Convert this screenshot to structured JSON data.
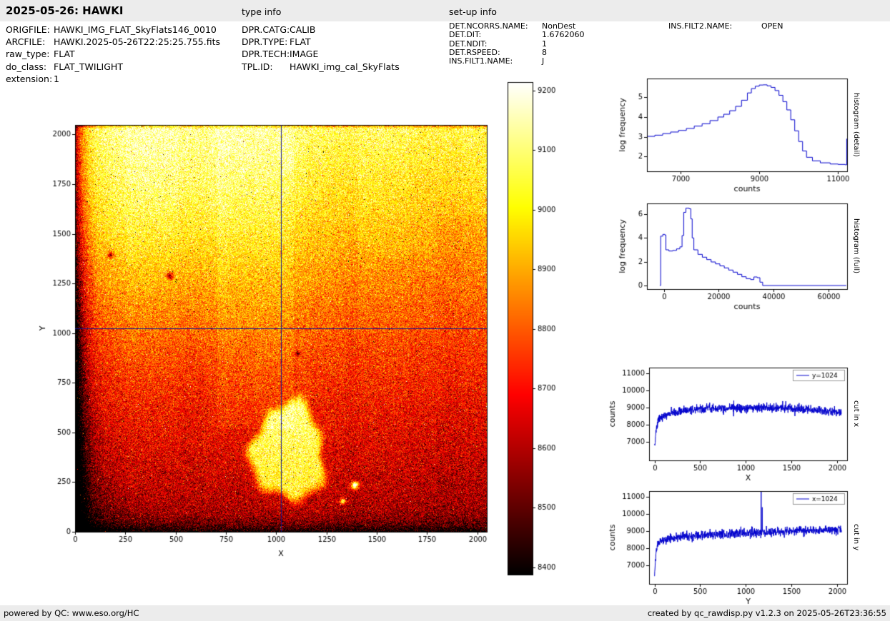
{
  "header": {
    "title": "2025-05-26: HAWKI",
    "type_info_label": "type info",
    "setup_info_label": "set-up info"
  },
  "metadata": {
    "file_info": [
      {
        "label": "ORIGFILE:",
        "value": "HAWKI_IMG_FLAT_SkyFlats146_0010"
      },
      {
        "label": "ARCFILE:",
        "value": "HAWKI.2025-05-26T22:25:25.755.fits"
      },
      {
        "label": "raw_type:",
        "value": "FLAT"
      },
      {
        "label": "do_class:",
        "value": "FLAT_TWILIGHT"
      },
      {
        "label": "extension:",
        "value": "1"
      }
    ],
    "type_info": [
      {
        "label": "DPR.CATG:",
        "value": "CALIB"
      },
      {
        "label": "DPR.TYPE:",
        "value": "FLAT"
      },
      {
        "label": "DPR.TECH:",
        "value": "IMAGE"
      },
      {
        "label": "TPL.ID:",
        "value": "HAWKI_img_cal_SkyFlats"
      }
    ],
    "setup_info": [
      {
        "label": "DET.NCORRS.NAME:",
        "value": "NonDest"
      },
      {
        "label": "DET.DIT:",
        "value": "1.6762060"
      },
      {
        "label": "DET.NDIT:",
        "value": "1"
      },
      {
        "label": "DET.RSPEED:",
        "value": "8"
      },
      {
        "label": "INS.FILT1.NAME:",
        "value": "J"
      }
    ],
    "setup_info2": [
      {
        "label": "INS.FILT2.NAME:",
        "value": "OPEN"
      }
    ]
  },
  "footer": {
    "left": "powered by QC: www.eso.org/HC",
    "right": "created by qc_rawdisp.py v1.2.3 on 2025-05-26T23:36:55"
  },
  "colors": {
    "line": "#0000cc",
    "crosshair": "#14148c",
    "bar_bg": "#ececec"
  },
  "chart_data": [
    {
      "id": "image",
      "type": "heatmap",
      "description": "2048x2048 raw sky flat frame, hot colormap, bright irregular blob lower-centre, dark left/bottom edges, crosshair at 1024/1024",
      "xlabel": "X",
      "ylabel": "Y",
      "xlim": [
        0,
        2048
      ],
      "ylim": [
        0,
        2048
      ],
      "xticks": [
        0,
        250,
        500,
        750,
        1000,
        1250,
        1500,
        1750,
        2000
      ],
      "yticks": [
        0,
        250,
        500,
        750,
        1000,
        1250,
        1500,
        1750,
        2000
      ],
      "colormap": "hot",
      "value_range": [
        8388,
        9214
      ],
      "crosshair": {
        "x": 1024,
        "y": 1024
      }
    },
    {
      "id": "colorbar",
      "type": "colorbar",
      "range": [
        8388,
        9214
      ],
      "ticks": [
        9200,
        9100,
        9000,
        8900,
        8800,
        8700,
        8600,
        8500,
        8400
      ]
    },
    {
      "id": "hist_detail",
      "type": "line",
      "side_label": "histogram (detail)",
      "xlabel": "counts",
      "ylabel": "log frequency",
      "xlim": [
        6150,
        11230
      ],
      "ylim": [
        1.25,
        5.95
      ],
      "xticks": [
        7000,
        9000,
        11000
      ],
      "yticks": [
        2,
        3,
        4,
        5
      ],
      "step": true,
      "points": [
        [
          6150,
          3.02
        ],
        [
          6350,
          3.08
        ],
        [
          6550,
          3.16
        ],
        [
          6750,
          3.24
        ],
        [
          6950,
          3.32
        ],
        [
          7150,
          3.42
        ],
        [
          7350,
          3.54
        ],
        [
          7550,
          3.66
        ],
        [
          7750,
          3.82
        ],
        [
          7950,
          4.0
        ],
        [
          8100,
          4.14
        ],
        [
          8250,
          4.32
        ],
        [
          8400,
          4.54
        ],
        [
          8550,
          4.85
        ],
        [
          8700,
          5.22
        ],
        [
          8800,
          5.44
        ],
        [
          8900,
          5.56
        ],
        [
          9000,
          5.62
        ],
        [
          9100,
          5.63
        ],
        [
          9200,
          5.58
        ],
        [
          9300,
          5.5
        ],
        [
          9400,
          5.34
        ],
        [
          9500,
          5.1
        ],
        [
          9600,
          4.78
        ],
        [
          9700,
          4.36
        ],
        [
          9800,
          3.86
        ],
        [
          9900,
          3.3
        ],
        [
          10000,
          2.76
        ],
        [
          10100,
          2.28
        ],
        [
          10200,
          1.96
        ],
        [
          10350,
          1.78
        ],
        [
          10550,
          1.68
        ],
        [
          10800,
          1.62
        ],
        [
          11000,
          1.6
        ],
        [
          11180,
          1.58
        ],
        [
          11220,
          2.9
        ]
      ]
    },
    {
      "id": "hist_full",
      "type": "line",
      "side_label": "histogram (full)",
      "xlabel": "counts",
      "ylabel": "log frequency",
      "xlim": [
        -6200,
        66800
      ],
      "ylim": [
        -0.3,
        6.9
      ],
      "xticks": [
        0,
        20000,
        40000,
        60000
      ],
      "yticks": [
        0,
        2,
        4,
        6
      ],
      "step": true,
      "points": [
        [
          -1500,
          0.0
        ],
        [
          -1200,
          4.15
        ],
        [
          -400,
          4.3
        ],
        [
          300,
          4.25
        ],
        [
          700,
          3.0
        ],
        [
          1800,
          2.9
        ],
        [
          3200,
          2.95
        ],
        [
          4600,
          3.08
        ],
        [
          5800,
          3.25
        ],
        [
          6600,
          4.2
        ],
        [
          7200,
          6.15
        ],
        [
          8000,
          6.5
        ],
        [
          9200,
          6.45
        ],
        [
          9800,
          5.6
        ],
        [
          10300,
          4.0
        ],
        [
          10900,
          3.0
        ],
        [
          12400,
          2.62
        ],
        [
          14000,
          2.38
        ],
        [
          15600,
          2.18
        ],
        [
          17200,
          1.98
        ],
        [
          18800,
          1.82
        ],
        [
          20400,
          1.65
        ],
        [
          22000,
          1.48
        ],
        [
          23600,
          1.3
        ],
        [
          25200,
          1.12
        ],
        [
          26800,
          0.94
        ],
        [
          28400,
          0.74
        ],
        [
          30000,
          0.58
        ],
        [
          31600,
          0.5
        ],
        [
          32800,
          0.72
        ],
        [
          34000,
          0.66
        ],
        [
          35000,
          0.28
        ],
        [
          36000,
          0.0
        ],
        [
          66500,
          0.0
        ]
      ]
    },
    {
      "id": "cut_x",
      "type": "line",
      "side_label": "cut in x",
      "legend": "y=1024",
      "xlabel": "X",
      "ylabel": "counts",
      "xlim": [
        -60,
        2110
      ],
      "ylim": [
        5900,
        11350
      ],
      "xticks": [
        0,
        500,
        1000,
        1500,
        2000
      ],
      "yticks": [
        7000,
        8000,
        9000,
        10000,
        11000
      ],
      "noise_sigma": 130,
      "seed": 7,
      "anchors": [
        [
          0,
          6500
        ],
        [
          15,
          7600
        ],
        [
          40,
          8250
        ],
        [
          80,
          8450
        ],
        [
          150,
          8600
        ],
        [
          250,
          8750
        ],
        [
          350,
          8850
        ],
        [
          500,
          8950
        ],
        [
          700,
          9000
        ],
        [
          900,
          8980
        ],
        [
          1100,
          9000
        ],
        [
          1300,
          8980
        ],
        [
          1500,
          8950
        ],
        [
          1700,
          8900
        ],
        [
          1850,
          8820
        ],
        [
          1950,
          8780
        ],
        [
          2048,
          8720
        ]
      ],
      "spikes": []
    },
    {
      "id": "cut_y",
      "type": "line",
      "side_label": "cut in y",
      "legend": "x=1024",
      "xlabel": "Y",
      "ylabel": "counts",
      "xlim": [
        -60,
        2110
      ],
      "ylim": [
        5900,
        11350
      ],
      "xticks": [
        0,
        500,
        1000,
        1500,
        2000
      ],
      "yticks": [
        7000,
        8000,
        9000,
        10000,
        11000
      ],
      "noise_sigma": 130,
      "seed": 11,
      "anchors": [
        [
          0,
          6500
        ],
        [
          15,
          7800
        ],
        [
          40,
          8300
        ],
        [
          100,
          8500
        ],
        [
          200,
          8600
        ],
        [
          350,
          8700
        ],
        [
          500,
          8750
        ],
        [
          700,
          8800
        ],
        [
          900,
          8850
        ],
        [
          1100,
          8900
        ],
        [
          1300,
          8950
        ],
        [
          1500,
          9000
        ],
        [
          1700,
          9020
        ],
        [
          1900,
          9080
        ],
        [
          2048,
          9100
        ]
      ],
      "spikes": [
        [
          1168,
          11500
        ],
        [
          1180,
          10400
        ]
      ]
    }
  ]
}
